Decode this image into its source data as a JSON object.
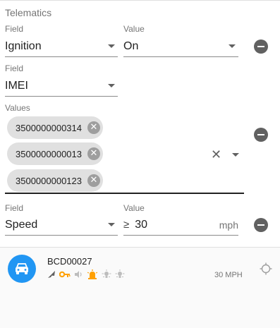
{
  "section": {
    "title": "Telematics"
  },
  "row1": {
    "field_label": "Field",
    "field_value": "Ignition",
    "value_label": "Value",
    "value_value": "On"
  },
  "row2": {
    "field_label": "Field",
    "field_value": "IMEI",
    "values_label": "Values",
    "chips": [
      "3500000000314",
      "3500000000013",
      "3500000000123"
    ],
    "chip_remove_glyph": "✕",
    "clear_glyph": "✕"
  },
  "row3": {
    "field_label": "Field",
    "field_value": "Speed",
    "value_label": "Value",
    "operator": "≥",
    "value_value": "30",
    "unit": "mph"
  },
  "vehicle": {
    "name": "BCD00027",
    "speed": "30 MPH",
    "avatar_icon": "car-icon",
    "status_icons": [
      "navigation-arrow-icon",
      "key-icon",
      "speaker-icon",
      "siren-icon",
      "light-icon",
      "light-icon"
    ],
    "locate_icon": "crosshair-icon"
  },
  "colors": {
    "accent": "#2196f3",
    "warning": "#ffa000",
    "icon_gray": "#616161",
    "muted": "#bdbdbd"
  }
}
